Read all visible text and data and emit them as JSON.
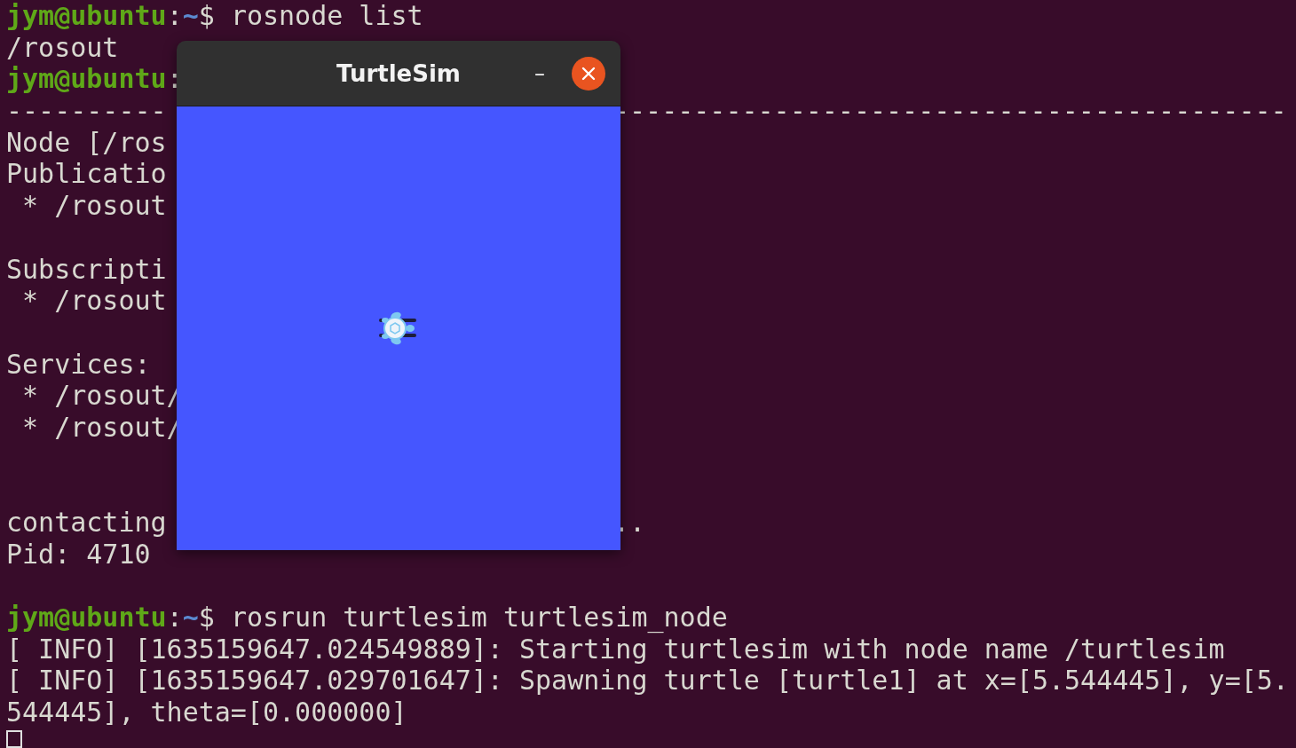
{
  "terminal": {
    "lines": [
      {
        "kind": "prompt",
        "user": "jym@ubuntu",
        "sep": ":",
        "path": "~",
        "symbol": "$",
        "command": "rosnode list"
      },
      {
        "kind": "output",
        "text": "/rosout"
      },
      {
        "kind": "prompt",
        "user": "jym@ubuntu",
        "sep": ":"
      },
      {
        "kind": "split",
        "text": "----------",
        "right": "------------------------------------------"
      },
      {
        "kind": "output",
        "text": "Node [/ros"
      },
      {
        "kind": "output",
        "text": "Publicatio"
      },
      {
        "kind": "output",
        "text": " * /rosout"
      },
      {
        "kind": "blank"
      },
      {
        "kind": "output",
        "text": "Subscripti"
      },
      {
        "kind": "output",
        "text": " * /rosout"
      },
      {
        "kind": "blank"
      },
      {
        "kind": "output",
        "text": "Services:"
      },
      {
        "kind": "output",
        "text": " * /rosout/"
      },
      {
        "kind": "output",
        "text": " * /rosout/"
      },
      {
        "kind": "blank"
      },
      {
        "kind": "blank"
      },
      {
        "kind": "split",
        "text": "contacting",
        "right": ".."
      },
      {
        "kind": "output",
        "text": "Pid: 4710"
      },
      {
        "kind": "blank"
      },
      {
        "kind": "prompt",
        "user": "jym@ubuntu",
        "sep": ":",
        "path": "~",
        "symbol": "$",
        "command": "rosrun turtlesim turtlesim_node"
      },
      {
        "kind": "output",
        "text": "[ INFO] [1635159647.024549889]: Starting turtlesim with node name /turtlesim"
      },
      {
        "kind": "output",
        "text": "[ INFO] [1635159647.029701647]: Spawning turtle [turtle1] at x=[5.544445], y=[5."
      },
      {
        "kind": "output",
        "text": "544445], theta=[0.000000]"
      },
      {
        "kind": "cursor"
      }
    ]
  },
  "window": {
    "title": "TurtleSim",
    "minimize": "–"
  }
}
